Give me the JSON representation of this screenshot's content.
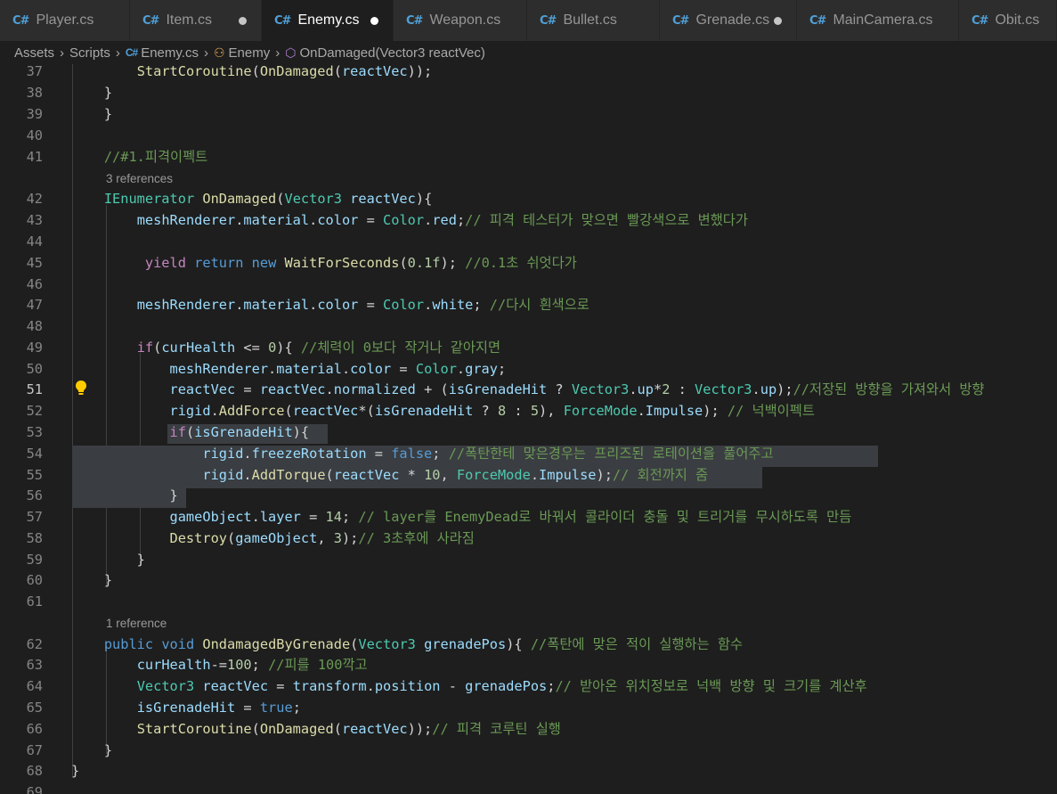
{
  "tabs": [
    {
      "label": "Player.cs",
      "icon": "csharp-file-icon",
      "dirty": false,
      "active": false
    },
    {
      "label": "Item.cs",
      "icon": "csharp-file-icon",
      "dirty": true,
      "active": false
    },
    {
      "label": "Enemy.cs",
      "icon": "csharp-file-icon",
      "dirty": true,
      "active": true
    },
    {
      "label": "Weapon.cs",
      "icon": "csharp-file-icon",
      "dirty": false,
      "active": false
    },
    {
      "label": "Bullet.cs",
      "icon": "csharp-file-icon",
      "dirty": false,
      "active": false
    },
    {
      "label": "Grenade.cs",
      "icon": "csharp-file-icon",
      "dirty": true,
      "active": false
    },
    {
      "label": "MainCamera.cs",
      "icon": "csharp-file-icon",
      "dirty": false,
      "active": false
    },
    {
      "label": "Obit.cs",
      "icon": "csharp-file-icon",
      "dirty": false,
      "active": false
    }
  ],
  "breadcrumb": {
    "folder1": "Assets",
    "folder2": "Scripts",
    "file": "Enemy.cs",
    "class": "Enemy",
    "method": "OnDamaged(Vector3 reactVec)"
  },
  "codelens": {
    "line42": "3 references",
    "line62": "1 reference"
  },
  "current_line": 51,
  "lines": [
    {
      "n": 37,
      "t": "        StartCoroutine(OnDamaged(reactVec));"
    },
    {
      "n": 38,
      "t": "    }"
    },
    {
      "n": 39,
      "t": "    }"
    },
    {
      "n": 40,
      "t": ""
    },
    {
      "n": 41,
      "t": "    //#1.피격이펙트"
    },
    {
      "n": 42,
      "t": "    IEnumerator OnDamaged(Vector3 reactVec){"
    },
    {
      "n": 43,
      "t": "        meshRenderer.material.color = Color.red;// 피격 테스터가 맞으면 빨강색으로 변했다가"
    },
    {
      "n": 44,
      "t": ""
    },
    {
      "n": 45,
      "t": "         yield return new WaitForSeconds(0.1f); //0.1초 쉬엇다가"
    },
    {
      "n": 46,
      "t": ""
    },
    {
      "n": 47,
      "t": "        meshRenderer.material.color = Color.white; //다시 흰색으로"
    },
    {
      "n": 48,
      "t": ""
    },
    {
      "n": 49,
      "t": "        if(curHealth <= 0){ //체력이 0보다 작거나 같아지면"
    },
    {
      "n": 50,
      "t": "            meshRenderer.material.color = Color.gray;"
    },
    {
      "n": 51,
      "t": "            reactVec = reactVec.normalized + (isGrenadeHit ? Vector3.up*2 : Vector3.up);//저장된 방향을 가져와서 방향"
    },
    {
      "n": 52,
      "t": "            rigid.AddForce(reactVec*(isGrenadeHit ? 8 : 5), ForceMode.Impulse); // 넉백이펙트"
    },
    {
      "n": 53,
      "t": "            if(isGrenadeHit){"
    },
    {
      "n": 54,
      "t": "                rigid.freezeRotation = false; //폭탄한테 맞은경우는 프리즈된 로테이션을 풀어주고"
    },
    {
      "n": 55,
      "t": "                rigid.AddTorque(reactVec * 10, ForceMode.Impulse);// 회전까지 줌"
    },
    {
      "n": 56,
      "t": "            }"
    },
    {
      "n": 57,
      "t": "            gameObject.layer = 14; // layer를 EnemyDead로 바꿔서 콜라이더 충돌 및 트리거를 무시하도록 만듬"
    },
    {
      "n": 58,
      "t": "            Destroy(gameObject, 3);// 3초후에 사라짐"
    },
    {
      "n": 59,
      "t": "        }"
    },
    {
      "n": 60,
      "t": "    }"
    },
    {
      "n": 61,
      "t": ""
    },
    {
      "n": 62,
      "t": "    public void OndamagedByGrenade(Vector3 grenadePos){ //폭탄에 맞은 적이 실행하는 함수"
    },
    {
      "n": 63,
      "t": "        curHealth-=100; //피를 100깍고"
    },
    {
      "n": 64,
      "t": "        Vector3 reactVec = transform.position - grenadePos;// 받아온 위치정보로 넉백 방향 및 크기를 계산후"
    },
    {
      "n": 65,
      "t": "        isGrenadeHit = true;"
    },
    {
      "n": 66,
      "t": "        StartCoroutine(OnDamaged(reactVec));// 피격 코루틴 실행"
    },
    {
      "n": 67,
      "t": "    }"
    },
    {
      "n": 68,
      "t": "}"
    },
    {
      "n": 69,
      "t": ""
    }
  ],
  "colors": {
    "editor_bg": "#1e1e1e",
    "tabbar_bg": "#252526",
    "keyword": "#569cd6",
    "control": "#c586c0",
    "type": "#4ec9b0",
    "function": "#dcdcaa",
    "variable": "#9cdcfe",
    "number": "#b5cea8",
    "comment": "#6a9955",
    "selection": "#3a3d41"
  }
}
